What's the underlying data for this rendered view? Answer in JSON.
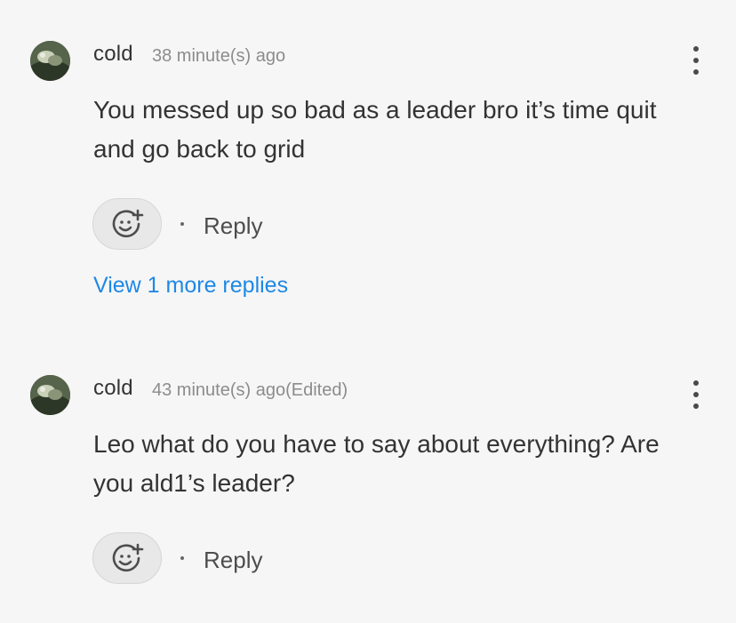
{
  "comments": [
    {
      "username": "cold",
      "timestamp": "38 minute(s) ago",
      "text_lines": [
        "You messed up so bad as a leader bro it’s time quit",
        "and go back to grid"
      ],
      "reply_label": "Reply",
      "view_replies_label": "View 1 more replies"
    },
    {
      "username": "cold",
      "timestamp": "43 minute(s) ago(Edited)",
      "text_lines": [
        "Leo what do you have to say about everything? Are",
        "you ald1’s leader?"
      ],
      "reply_label": "Reply"
    }
  ],
  "icons": {
    "more": "vertical-dots-icon",
    "reaction": "add-reaction-smiley-icon",
    "separator": "dot-separator"
  },
  "colors": {
    "background": "#f6f6f6",
    "link": "#1e88e5",
    "text": "#333333",
    "muted": "#8c8c8c"
  }
}
